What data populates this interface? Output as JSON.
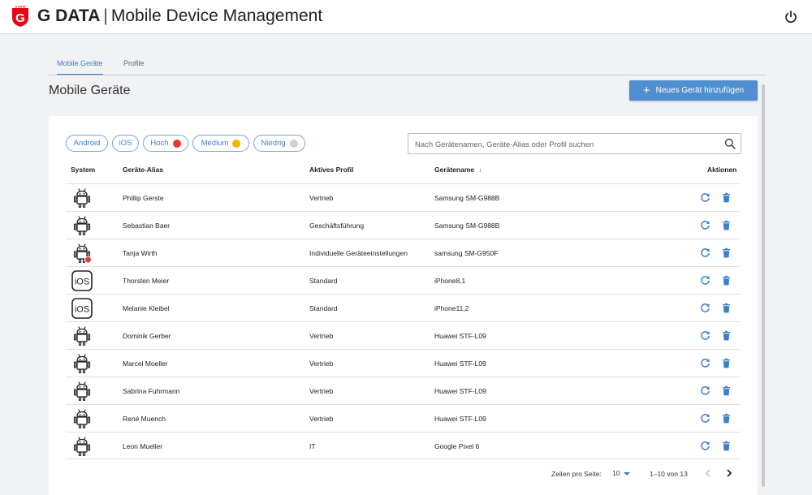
{
  "brand": {
    "logo_text": "G DATA",
    "name": "G DATA",
    "separator": "|",
    "product": "Mobile Device Management",
    "accent": "#e30613"
  },
  "tabs": [
    {
      "label": "Mobile Geräte",
      "active": true
    },
    {
      "label": "Profile",
      "active": false
    }
  ],
  "page": {
    "title": "Mobile Geräte",
    "add_button": "Neues Gerät hinzufügen"
  },
  "filters": [
    {
      "label": "Android",
      "dot": null
    },
    {
      "label": "iOS",
      "dot": null
    },
    {
      "label": "Hoch",
      "dot": "#e53935"
    },
    {
      "label": "Medium",
      "dot": "#f4b400"
    },
    {
      "label": "Niedrig",
      "dot": "#d0d0d0"
    }
  ],
  "search": {
    "placeholder": "Nach Gerätenamen, Geräte-Alias oder Profil suchen",
    "value": ""
  },
  "table": {
    "headers": {
      "system": "System",
      "alias": "Geräte-Alias",
      "profile": "Aktives Profil",
      "device": "Gerätename",
      "actions": "Aktionen"
    },
    "sorted_column": "device",
    "rows": [
      {
        "system": "android",
        "alert": false,
        "alias": "Phillip Gerste",
        "profile": "Vertrieb",
        "device": "Samsung SM-G988B"
      },
      {
        "system": "android",
        "alert": false,
        "alias": "Sebastian Baer",
        "profile": "Geschäftsführung",
        "device": "Samsung SM-G988B"
      },
      {
        "system": "android",
        "alert": true,
        "alias": "Tanja Wirth",
        "profile": "Individuelle Geräteeinstellungen",
        "device": "samsung SM-G950F"
      },
      {
        "system": "ios",
        "alert": false,
        "alias": "Thorsten Meier",
        "profile": "Standard",
        "device": "iPhone8,1"
      },
      {
        "system": "ios",
        "alert": false,
        "alias": "Melanie Kleibel",
        "profile": "Standard",
        "device": "iPhone11,2"
      },
      {
        "system": "android",
        "alert": false,
        "alias": "Dominik Gerber",
        "profile": "Vertrieb",
        "device": "Huawei STF-L09"
      },
      {
        "system": "android",
        "alert": false,
        "alias": "Marcel Moeller",
        "profile": "Vertrieb",
        "device": "Huawei STF-L09"
      },
      {
        "system": "android",
        "alert": false,
        "alias": "Sabrina Fuhrmann",
        "profile": "Vertrieb",
        "device": "Huawei STF-L09"
      },
      {
        "system": "android",
        "alert": false,
        "alias": "René Muench",
        "profile": "Vertrieb",
        "device": "Huawei STF-L09"
      },
      {
        "system": "android",
        "alert": false,
        "alias": "Leon Mueller",
        "profile": "IT",
        "device": "Google Pixel 6"
      }
    ]
  },
  "pagination": {
    "rows_per_page_label": "Zeilen pro Seite:",
    "rows_per_page": "10",
    "range": "1–10 von 13"
  },
  "ios_icon_text": "iOS",
  "colors": {
    "accent_blue": "#3d7fc6",
    "button_blue": "#4f8fcf",
    "alert_red": "#e53935"
  }
}
